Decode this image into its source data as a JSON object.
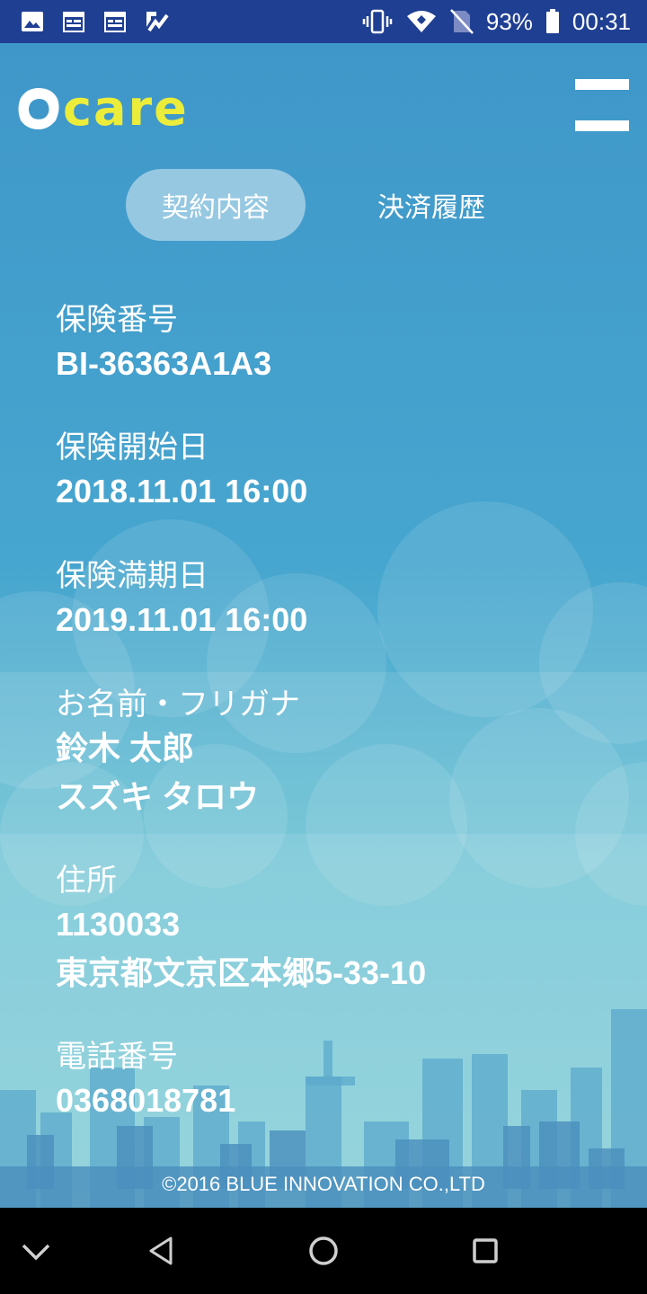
{
  "status_bar": {
    "battery": "93%",
    "time": "00:31",
    "icons": [
      "image-icon",
      "calendar-icon",
      "calendar-icon",
      "check-app-icon",
      "vibrate-icon",
      "wifi-icon",
      "no-sim-icon",
      "battery-icon"
    ]
  },
  "header": {
    "logo_text": "care",
    "menu_icon": "hamburger-menu-icon"
  },
  "tabs": [
    {
      "label": "契約内容",
      "active": true
    },
    {
      "label": "決済履歴",
      "active": false
    }
  ],
  "fields": [
    {
      "label": "保険番号",
      "values": [
        "BI-36363A1A3"
      ]
    },
    {
      "label": "保険開始日",
      "values": [
        "2018.11.01 16:00"
      ]
    },
    {
      "label": "保険満期日",
      "values": [
        "2019.11.01 16:00"
      ]
    },
    {
      "label": "お名前・フリガナ",
      "values": [
        "鈴木 太郎",
        "スズキ タロウ"
      ]
    },
    {
      "label": "住所",
      "values": [
        "1130033",
        "東京都文京区本郷5-33-10"
      ]
    },
    {
      "label": "電話番号",
      "values": [
        "0368018781"
      ]
    }
  ],
  "footer": {
    "copyright": "©2016 BLUE INNOVATION CO.,LTD"
  },
  "nav_bar": {
    "icons": [
      "chevron-down-icon",
      "back-triangle-icon",
      "home-circle-icon",
      "recents-square-icon"
    ]
  },
  "colors": {
    "status_bar": "#1f3f92",
    "logo_yellow": "#ecec3a",
    "sky_top": "#3f97c9",
    "sky_bottom": "#7ecbd6",
    "nav_bar": "#000000"
  }
}
